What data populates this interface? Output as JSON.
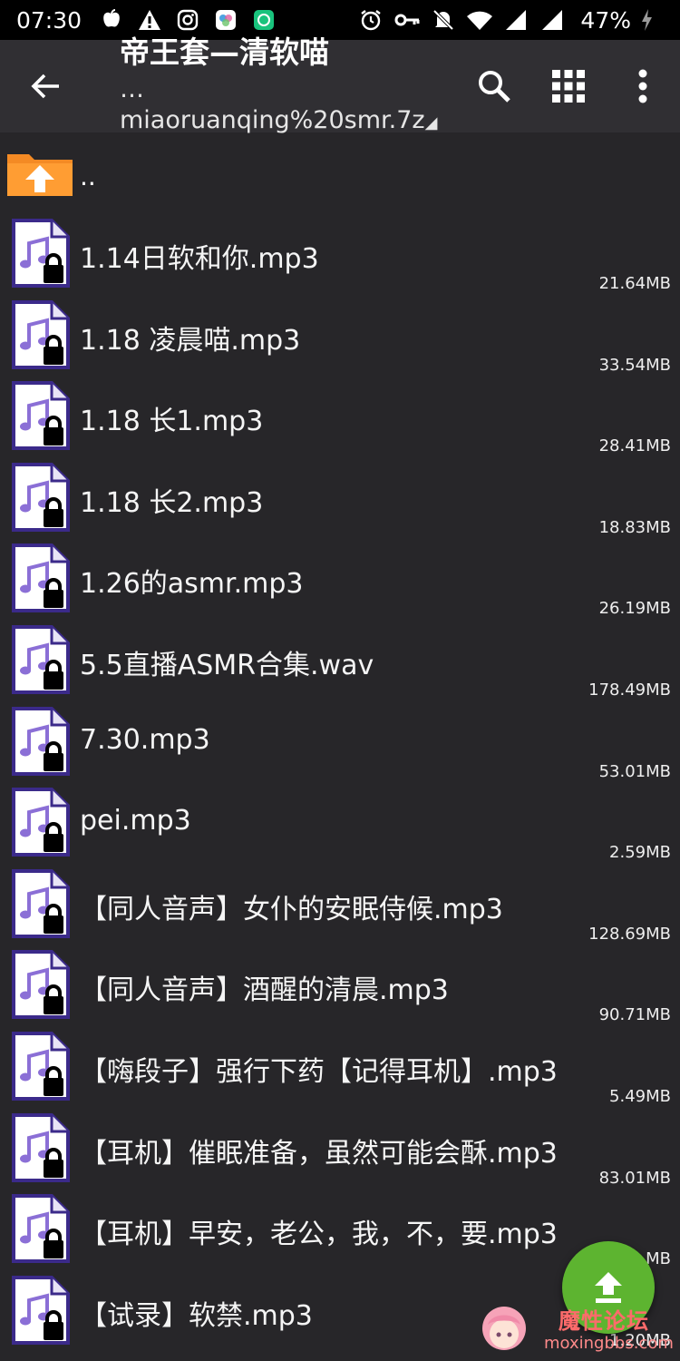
{
  "status_bar": {
    "time": "07:30",
    "battery": "47%",
    "icons_left": [
      "apple-notification-icon",
      "warning-icon",
      "instagram-icon",
      "photos-app-icon",
      "chatgpt-icon"
    ],
    "icons_right": [
      "alarm-icon",
      "vpn-key-icon",
      "mute-icon",
      "wifi-icon",
      "signal-icon",
      "signal-icon-2",
      "charging-icon"
    ]
  },
  "app_bar": {
    "title": "帝王套—清软喵",
    "subtitle": "…miaoruanqing%20smr.7z",
    "actions": [
      "search-icon",
      "grid-view-icon",
      "more-options-icon"
    ]
  },
  "parent_dir": {
    "label": ".."
  },
  "files": [
    {
      "name": "1.14日软和你.mp3",
      "size": "21.64MB"
    },
    {
      "name": "1.18 凌晨喵.mp3",
      "size": "33.54MB"
    },
    {
      "name": "1.18 长1.mp3",
      "size": "28.41MB"
    },
    {
      "name": "1.18 长2.mp3",
      "size": "18.83MB"
    },
    {
      "name": "1.26的asmr.mp3",
      "size": "26.19MB"
    },
    {
      "name": "5.5直播ASMR合集.wav",
      "size": "178.49MB"
    },
    {
      "name": "7.30.mp3",
      "size": "53.01MB"
    },
    {
      "name": "pei.mp3",
      "size": "2.59MB"
    },
    {
      "name": "【同人音声】女仆的安眠侍候.mp3",
      "size": "128.69MB"
    },
    {
      "name": "【同人音声】酒醒的清晨.mp3",
      "size": "90.71MB"
    },
    {
      "name": "【嗨段子】强行下药【记得耳机】.mp3",
      "size": "5.49MB"
    },
    {
      "name": "【耳机】催眠准备，虽然可能会酥.mp3",
      "size": "83.01MB"
    },
    {
      "name": "【耳机】早安，老公，我，不，要.mp3",
      "size": "…MB"
    },
    {
      "name": "【试录】软禁.mp3",
      "size": "1.20MB"
    }
  ],
  "watermark": {
    "text": "魔性论坛",
    "url": "moxingbbs.com"
  },
  "colors": {
    "background": "#272629",
    "appbar": "#302f33",
    "fab": "#5db430",
    "folder": "#f48a24",
    "file_icon_border": "#3b2a8a"
  }
}
